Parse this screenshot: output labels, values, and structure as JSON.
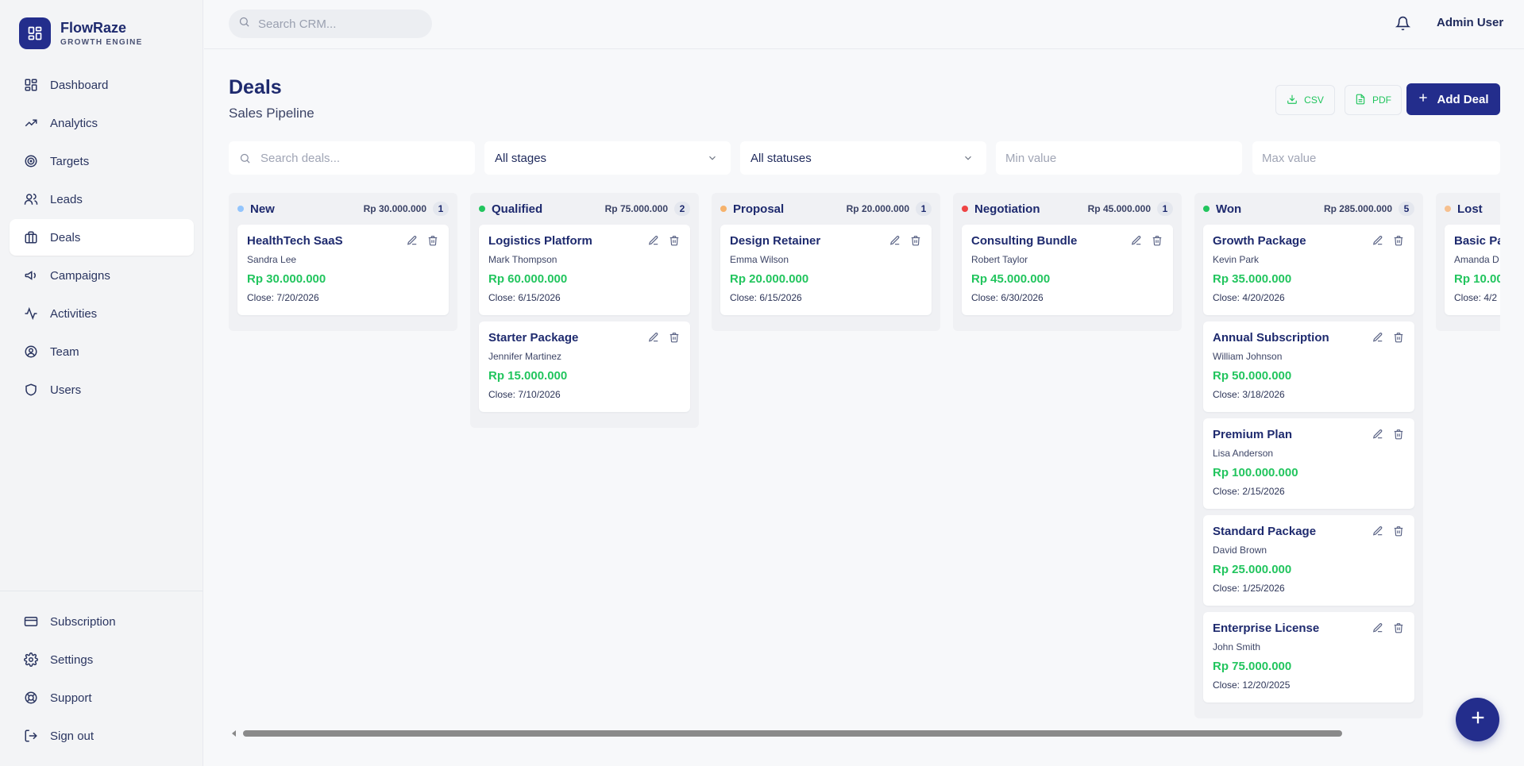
{
  "brand": {
    "name": "FlowRaze",
    "subtitle": "GROWTH ENGINE"
  },
  "sidebar": {
    "items": [
      {
        "label": "Dashboard",
        "icon": "dashboard-icon"
      },
      {
        "label": "Analytics",
        "icon": "trending-up-icon"
      },
      {
        "label": "Targets",
        "icon": "target-icon"
      },
      {
        "label": "Leads",
        "icon": "users-icon"
      },
      {
        "label": "Deals",
        "icon": "briefcase-icon",
        "active": true
      },
      {
        "label": "Campaigns",
        "icon": "megaphone-icon"
      },
      {
        "label": "Activities",
        "icon": "activity-icon"
      },
      {
        "label": "Team",
        "icon": "user-circle-icon"
      },
      {
        "label": "Users",
        "icon": "shield-icon"
      }
    ],
    "bottom": [
      {
        "label": "Subscription",
        "icon": "credit-card-icon"
      },
      {
        "label": "Settings",
        "icon": "gear-icon"
      },
      {
        "label": "Support",
        "icon": "lifebuoy-icon"
      },
      {
        "label": "Sign out",
        "icon": "sign-out-icon"
      }
    ]
  },
  "topbar": {
    "search_placeholder": "Search CRM...",
    "user": "Admin User"
  },
  "page": {
    "title": "Deals",
    "subtitle": "Sales Pipeline",
    "csv_label": "CSV",
    "pdf_label": "PDF",
    "add_label": "Add Deal"
  },
  "filters": {
    "search_placeholder": "Search deals...",
    "stage_value": "All stages",
    "status_value": "All statuses",
    "min_placeholder": "Min value",
    "max_placeholder": "Max value"
  },
  "colors": {
    "accent": "#232d8c",
    "value_green": "#22c55e",
    "stage_new": "#93c5fd",
    "stage_qualified": "#22c55e",
    "stage_proposal": "#f6b26b",
    "stage_negotiation": "#ef4444",
    "stage_won": "#22c55e",
    "stage_lost": "#f6c08f"
  },
  "columns": [
    {
      "name": "New",
      "total": "Rp 30.000.000",
      "count": "1",
      "color": "#93c5fd",
      "deals": [
        {
          "title": "HealthTech SaaS",
          "person": "Sandra Lee",
          "value": "Rp 30.000.000",
          "close": "Close: 7/20/2026"
        }
      ]
    },
    {
      "name": "Qualified",
      "total": "Rp 75.000.000",
      "count": "2",
      "color": "#22c55e",
      "deals": [
        {
          "title": "Logistics Platform",
          "person": "Mark Thompson",
          "value": "Rp 60.000.000",
          "close": "Close: 6/15/2026"
        },
        {
          "title": "Starter Package",
          "person": "Jennifer Martinez",
          "value": "Rp 15.000.000",
          "close": "Close: 7/10/2026"
        }
      ]
    },
    {
      "name": "Proposal",
      "total": "Rp 20.000.000",
      "count": "1",
      "color": "#f6b26b",
      "deals": [
        {
          "title": "Design Retainer",
          "person": "Emma Wilson",
          "value": "Rp 20.000.000",
          "close": "Close: 6/15/2026"
        }
      ]
    },
    {
      "name": "Negotiation",
      "total": "Rp 45.000.000",
      "count": "1",
      "color": "#ef4444",
      "deals": [
        {
          "title": "Consulting Bundle",
          "person": "Robert Taylor",
          "value": "Rp 45.000.000",
          "close": "Close: 6/30/2026"
        }
      ]
    },
    {
      "name": "Won",
      "total": "Rp 285.000.000",
      "count": "5",
      "color": "#22c55e",
      "deals": [
        {
          "title": "Growth Package",
          "person": "Kevin Park",
          "value": "Rp 35.000.000",
          "close": "Close: 4/20/2026"
        },
        {
          "title": "Annual Subscription",
          "person": "William Johnson",
          "value": "Rp 50.000.000",
          "close": "Close: 3/18/2026"
        },
        {
          "title": "Premium Plan",
          "person": "Lisa Anderson",
          "value": "Rp 100.000.000",
          "close": "Close: 2/15/2026"
        },
        {
          "title": "Standard Package",
          "person": "David Brown",
          "value": "Rp 25.000.000",
          "close": "Close: 1/25/2026"
        },
        {
          "title": "Enterprise License",
          "person": "John Smith",
          "value": "Rp 75.000.000",
          "close": "Close: 12/20/2025"
        }
      ]
    },
    {
      "name": "Lost",
      "total": "",
      "count": "",
      "color": "#f6c08f",
      "deals": [
        {
          "title": "Basic Pa",
          "person": "Amanda D",
          "value": "Rp 10.00",
          "close": "Close: 4/2"
        }
      ]
    }
  ]
}
